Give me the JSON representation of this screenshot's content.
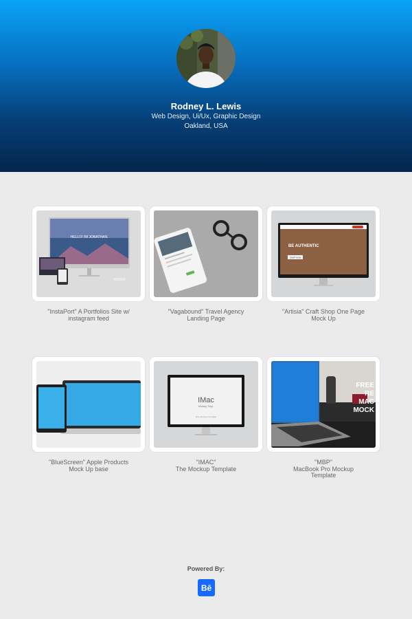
{
  "profile": {
    "name": "Rodney L. Lewis",
    "role": "Web Design, Ui/Ux, Graphic Design",
    "location": "Oakland, USA",
    "avatar_icon": "profile-photo"
  },
  "projects": [
    {
      "line1": "\"InstaPort\" A Portfolios Site w/",
      "line2": "instagram feed",
      "line3": "",
      "mock_screen_text": "HELLO! I'M JONATHAN."
    },
    {
      "line1": "\"Vagabound\" Travel Agency",
      "line2": "Landing Page",
      "line3": ""
    },
    {
      "line1": "\"Artisia\" Craft Shop One Page",
      "line2": "Mock Up",
      "line3": "",
      "mock_screen_text": "BE AUTHENTIC",
      "mock_button": "SHOP NOW"
    },
    {
      "line1": "\"BlueScreen\" Apple Products",
      "line2": "Mock Up base",
      "line3": ""
    },
    {
      "line1": "\"IMAC\"",
      "line2": "The Mockup Template",
      "line3": "",
      "mock_screen_text": "IMac",
      "mock_screen_sub": "Mockup Tmpl.",
      "mock_screen_foot": "Free Mockup Template"
    },
    {
      "line1": "\"MBP\"",
      "line2": "MacBook Pro Mockup",
      "line3": "Template",
      "mock_overlay": [
        "FREE",
        "RE",
        "MAC",
        "MOCK"
      ]
    }
  ],
  "footer": {
    "powered_label": "Powered By:",
    "behance_text": "Bē",
    "behance_color": "#1769ff"
  }
}
